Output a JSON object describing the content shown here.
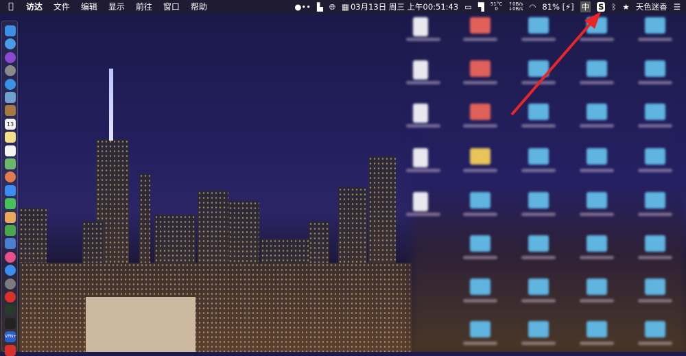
{
  "menubar": {
    "apple_icon": "apple-icon",
    "menus": [
      "访达",
      "文件",
      "编辑",
      "显示",
      "前往",
      "窗口",
      "帮助"
    ],
    "status": {
      "datetime": "03月13日 周三 上午00:51:43",
      "temperature": "51°C",
      "temp_sub": "0",
      "net_up": "↑0B/s",
      "net_down": "↓0B/s",
      "battery": "81%",
      "input_method": "中",
      "user_name": "天色迷香"
    }
  },
  "dock": {
    "apps": [
      "finder",
      "siri-assistant",
      "siri",
      "launchpad",
      "safari",
      "mail-photo",
      "notes-brown",
      "calendar",
      "notes",
      "reminders",
      "maps",
      "photos",
      "messages",
      "facetime",
      "pages",
      "numbers",
      "keynote",
      "itunes",
      "app-store",
      "system-preferences",
      "vivaldi",
      "activity-monitor",
      "terminal",
      "vpn",
      "other"
    ],
    "calendar_day": "13",
    "vpn_label": "VPN+"
  },
  "annotation": {
    "color": "#e8262a",
    "target": "bluetooth-icon"
  }
}
